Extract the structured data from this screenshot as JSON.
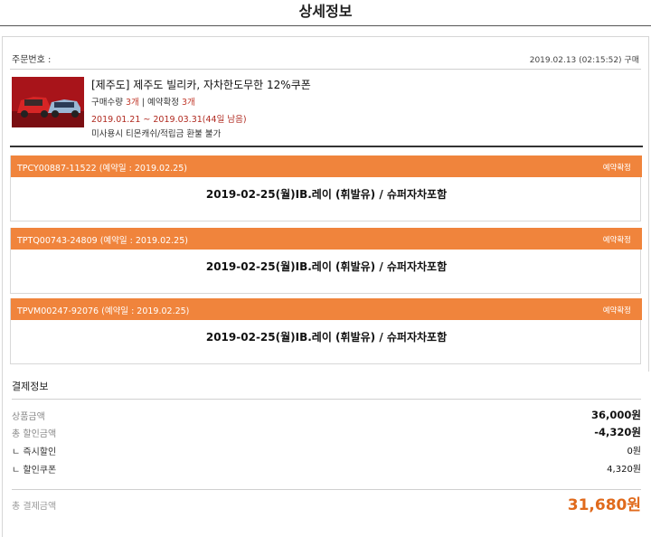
{
  "page": {
    "title": "상세정보"
  },
  "order": {
    "label": "주문번호 :",
    "date": "2019.02.13 (02:15:52) 구매"
  },
  "product": {
    "title": "[제주도] 제주도 빌리카, 자차한도무한 12%쿠폰",
    "qty_prefix": "구매수량 ",
    "qty_value": "3개",
    "qty_mid": " | 예약확정 ",
    "confirmed_value": "3개",
    "period": "2019.01.21 ~ 2019.03.31(44일 남음)",
    "note": "미사용시 티몬캐쉬/적립금 환불 불가"
  },
  "reservations": [
    {
      "code": "TPCY00887-11522 (예약일 : 2019.02.25)",
      "status": "예약확정",
      "desc": "2019-02-25(월)IB.레이 (휘발유) / 슈퍼자차포함"
    },
    {
      "code": "TPTQ00743-24809 (예약일 : 2019.02.25)",
      "status": "예약확정",
      "desc": "2019-02-25(월)IB.레이 (휘발유) / 슈퍼자차포함"
    },
    {
      "code": "TPVM00247-92076 (예약일 : 2019.02.25)",
      "status": "예약확정",
      "desc": "2019-02-25(월)IB.레이 (휘발유) / 슈퍼자차포함"
    }
  ],
  "payment": {
    "title": "결제정보",
    "rows": [
      {
        "label": "상품금액",
        "value": "36,000원"
      },
      {
        "label": "총 할인금액",
        "value": "-4,320원"
      },
      {
        "label": "ㄴ 즉시할인",
        "value": "0원"
      },
      {
        "label": "ㄴ 할인쿠폰",
        "value": "4,320원"
      }
    ],
    "total_label": "총 결제금액",
    "total_value": "31,680원"
  },
  "colors": {
    "accent": "#f0843c",
    "total": "#e06a1c",
    "period": "#b02a20"
  }
}
